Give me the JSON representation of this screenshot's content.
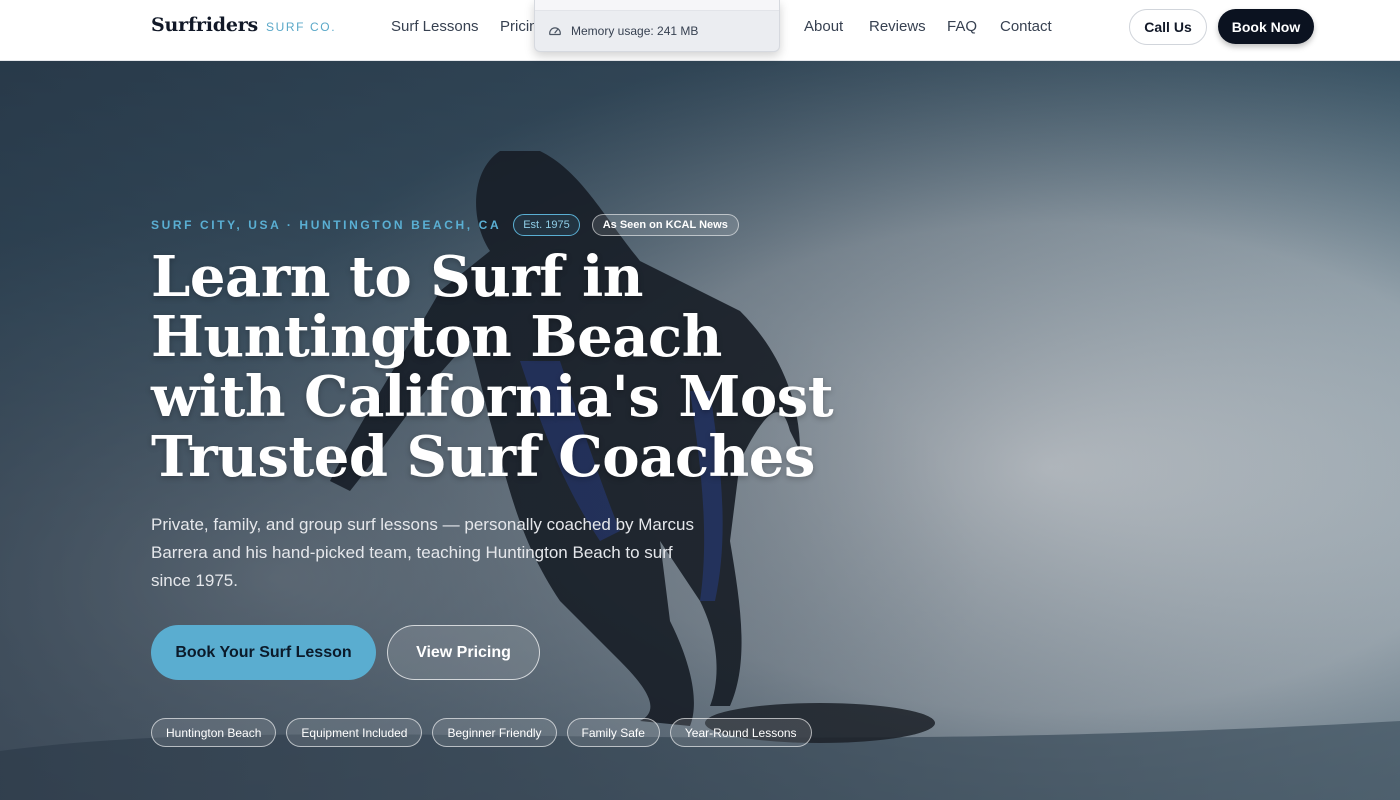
{
  "brand": {
    "name": "Surfriders",
    "tagline": "SURF CO."
  },
  "nav": {
    "links": [
      {
        "label": "Surf Lessons"
      },
      {
        "label": "Pricin"
      },
      {
        "label": "About"
      },
      {
        "label": "Reviews"
      },
      {
        "label": "FAQ"
      },
      {
        "label": "Contact"
      }
    ],
    "call_label": "Call Us",
    "book_label": "Book Now"
  },
  "memory_popup": {
    "text": "Memory usage: 241 MB",
    "icon": "gauge-icon"
  },
  "hero": {
    "eyebrow": "SURF CITY, USA · HUNTINGTON BEACH, CA",
    "est_badge": "Est. 1975",
    "press_badge": "As Seen on KCAL News",
    "headline": "Learn to Surf in Huntington Beach with California's Most Trusted Surf Coaches",
    "subtext": "Private, family, and group surf lessons — personally coached by Marcus Barrera and his hand-picked team, teaching Huntington Beach to surf since 1975.",
    "primary_cta": "Book Your Surf Lesson",
    "secondary_cta": "View Pricing",
    "tags": [
      "Huntington Beach",
      "Equipment Included",
      "Beginner Friendly",
      "Family Safe",
      "Year-Round Lessons"
    ]
  },
  "colors": {
    "accent": "#5aadd0",
    "dark": "#0b1220",
    "text_dark": "#111827"
  }
}
